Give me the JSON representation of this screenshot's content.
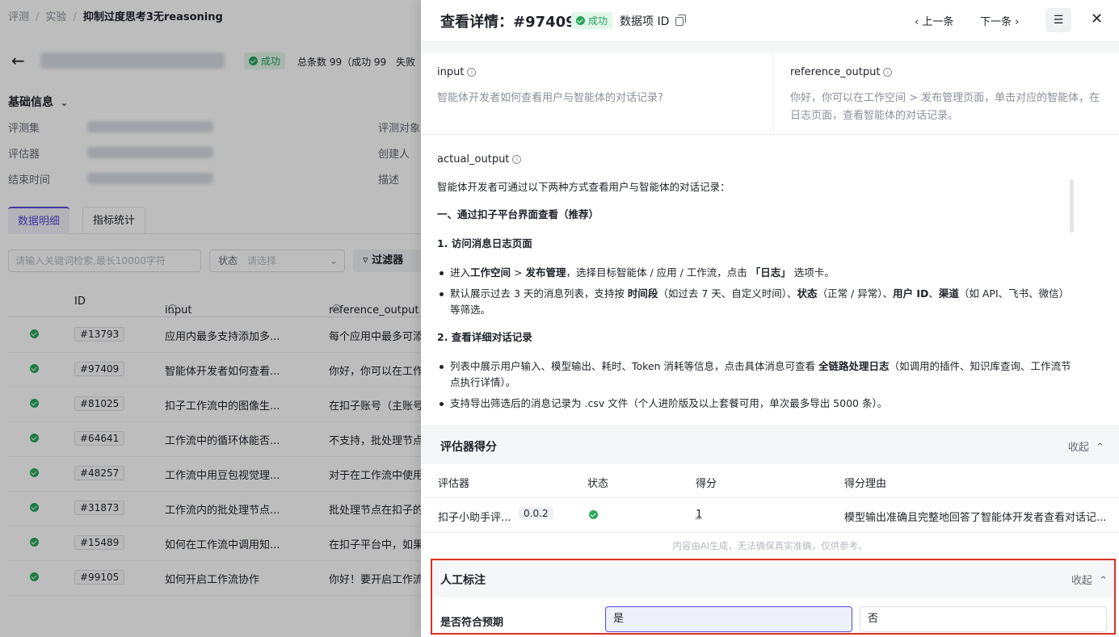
{
  "breadcrumb": [
    "评测",
    "实验",
    "抑制过度思考3无reasoning"
  ],
  "experiment": {
    "status": "成功",
    "summary": "总条数 99（成功 99　失败"
  },
  "basic_info": {
    "title": "基础信息",
    "labels": [
      "评测集",
      "评估器",
      "结束时间",
      "评测对象",
      "创建人",
      "描述"
    ]
  },
  "tabs": [
    "数据明细",
    "指标统计"
  ],
  "filters": {
    "search_placeholder": "请输入关键词检索,最长10000字符",
    "state_label": "状态",
    "state_placeholder": "请选择",
    "filter_button": "过滤器"
  },
  "list": {
    "headers": [
      "ID",
      "input",
      "reference_output"
    ],
    "rows": [
      {
        "id": "#13793",
        "input": "应用内最多支持添加多...",
        "ref": "每个应用中最多可添"
      },
      {
        "id": "#97409",
        "input": "智能体开发者如何查看...",
        "ref": "你好，你可以在工作"
      },
      {
        "id": "#81025",
        "input": "扣子工作流中的图像生...",
        "ref": "在扣子账号（主账号"
      },
      {
        "id": "#64641",
        "input": "工作流中的循环体能否...",
        "ref": "不支持，批处理节点"
      },
      {
        "id": "#48257",
        "input": "工作流中用豆包视觉理...",
        "ref": "对于在工作流中使用"
      },
      {
        "id": "#31873",
        "input": "工作流内的批处理节点...",
        "ref": "批处理节点在扣子的"
      },
      {
        "id": "#15489",
        "input": "如何在工作流中调用知...",
        "ref": "在扣子平台中，如果"
      },
      {
        "id": "#99105",
        "input": "如何开启工作流协作",
        "ref": "你好！要开启工作流"
      }
    ]
  },
  "drawer": {
    "title": "查看详情：#97409",
    "status": "成功",
    "data_id_label": "数据项 ID",
    "prev": "上一条",
    "next": "下一条",
    "input_label": "input",
    "input_value": "智能体开发者如何查看用户与智能体的对话记录?",
    "ref_label": "reference_output",
    "ref_value": "你好，你可以在工作空间 > 发布管理页面，单击对应的智能体，在日志页面，查看智能体的对话记录。",
    "actual_label": "actual_output",
    "actual": {
      "intro": "智能体开发者可通过以下两种方式查看用户与智能体的对话记录：",
      "h1": "一、通过扣子平台界面查看（推荐）",
      "s1": "1. 访问消息日志页面",
      "b1_pre": "进入",
      "b1_ws": "工作空间",
      "b1_gt": " > ",
      "b1_pm": "发布管理",
      "b1_mid": "，选择目标智能体 / 应用 / 工作流，点击 ",
      "b1_log": "「日志」",
      "b1_end": " 选项卡。",
      "b2_pre": "默认展示过去 3 天的消息列表，支持按 ",
      "b2_t": "时间段",
      "b2_a": "（如过去 7 天、自定义时间）、",
      "b2_s": "状态",
      "b2_b": "（正常 / 异常）、",
      "b2_u": "用户 ID",
      "b2_c": "、",
      "b2_ch": "渠道",
      "b2_end": "（如 API、飞书、微信）等筛选。",
      "s2": "2. 查看详细对话记录",
      "b3_pre": "列表中展示用户输入、模型输出、耗时、Token 消耗等信息，点击具体消息可查看 ",
      "b3_bold": "全链路处理日志",
      "b3_end": "（如调用的插件、知识库查询、工作流节点执行详情）。",
      "b4": "支持导出筛选后的消息记录为 .csv 文件（个人进阶版及以上套餐可用，单次最多导出 5000 条）。"
    },
    "eval": {
      "title": "评估器得分",
      "collapse": "收起",
      "headers": [
        "评估器",
        "状态",
        "得分",
        "得分理由"
      ],
      "row": {
        "name": "扣子小助手评...",
        "version": "0.0.2",
        "score": "1",
        "reason": "模型输出准确且完整地回答了智能体开发者查看对话记..."
      },
      "disclaimer": "内容由AI生成，无法确保真实准确，仅供参考。"
    },
    "manual": {
      "title": "人工标注",
      "collapse": "收起",
      "question": "是否符合预期",
      "options": [
        "是",
        "否"
      ],
      "selected": "是"
    }
  }
}
